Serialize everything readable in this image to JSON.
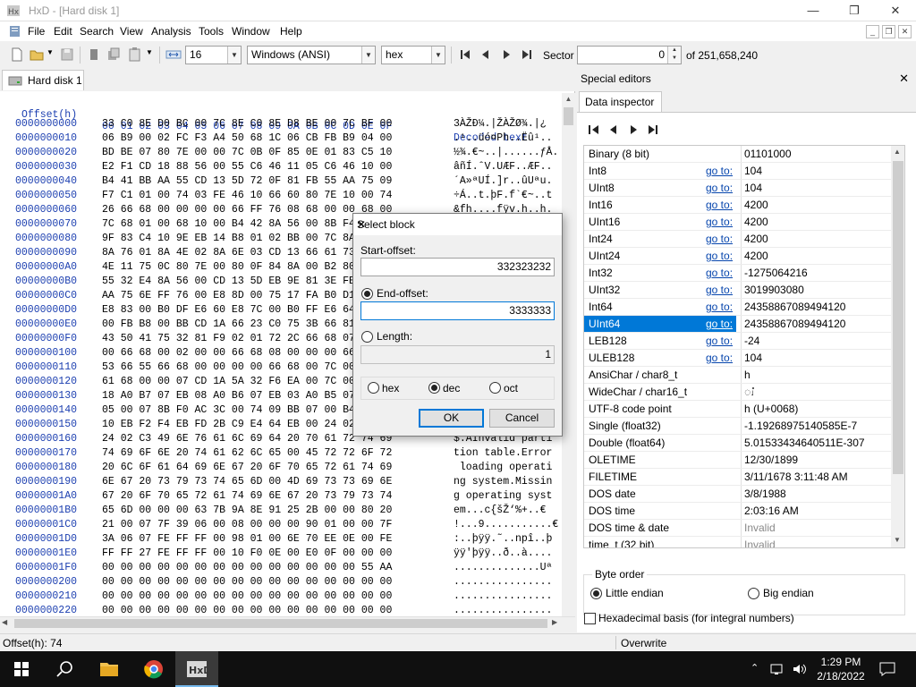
{
  "window": {
    "title": "HxD - [Hard disk 1]",
    "min_glyph": "—",
    "max_glyph": "❐",
    "close_glyph": "✕"
  },
  "menu": [
    "File",
    "Edit",
    "Search",
    "View",
    "Analysis",
    "Tools",
    "Window",
    "Help"
  ],
  "toolbar": {
    "columns": "16",
    "charset": "Windows (ANSI)",
    "display": "hex",
    "sector_label": "Sector",
    "sector_value": "0",
    "sector_total": "of 251,658,240"
  },
  "tab": {
    "label": "Hard disk 1"
  },
  "hex": {
    "header_offset": "Offset(h)",
    "header_bytes": "00 01 02 03 04 05 06 07 08 09 0A 0B 0C 0D 0E 0F",
    "header_decoded": "Decoded text",
    "rows": [
      {
        "off": "0000000000",
        "bytes": "33 C0 8E D0 BC 00 7C 8E C0 8E D8 BE 00 7C BF 00",
        "dec": "3ÀŽÐ¼.|ŽÀŽØ¾.|¿"
      },
      {
        "off": "0000000010",
        "bytes": "06 B9 00 02 FC F3 A4 50 68 1C 06 CB FB B9 04 00",
        "dec": ".¹..üó¤Ph..Ëû¹.."
      },
      {
        "off": "0000000020",
        "bytes": "BD BE 07 80 7E 00 00 7C 0B 0F 85 0E 01 83 C5 10",
        "dec": "½¾.€~..|......ƒÅ."
      },
      {
        "off": "0000000030",
        "bytes": "E2 F1 CD 18 88 56 00 55 C6 46 11 05 C6 46 10 00",
        "dec": "âñÍ.ˆV.UÆF..ÆF.."
      },
      {
        "off": "0000000040",
        "bytes": "B4 41 BB AA 55 CD 13 5D 72 0F 81 FB 55 AA 75 09",
        "dec": "´A»ªUÍ.]r..ûUªu."
      },
      {
        "off": "0000000050",
        "bytes": "F7 C1 01 00 74 03 FE 46 10 66 60 80 7E 10 00 74",
        "dec": "÷Á..t.þF.f`€~..t"
      },
      {
        "off": "0000000060",
        "bytes": "26 66 68 00 00 00 00 66 FF 76 08 68 00 00 68 00",
        "dec": "&fh....fÿv.h..h."
      },
      {
        "off": "0000000070",
        "bytes": "7C 68 01 00 68 10 00 B4 42 8A 56 00 8B F4 CD 13",
        "dec": "|h..h..´BŠV.‹ôÍ."
      },
      {
        "off": "0000000080",
        "bytes": "9F 83 C4 10 9E EB 14 B8 01 02 BB 00 7C 8A 56 00",
        "dec": "ŸƒÄ.žë.¸..».|ŠV."
      },
      {
        "off": "0000000090",
        "bytes": "8A 76 01 8A 4E 02 8A 6E 03 CD 13 66 61 73 1C FE",
        "dec": "Šv.ŠN.Šn.Í.fas.þ"
      },
      {
        "off": "00000000A0",
        "bytes": "4E 11 75 0C 80 7E 00 80 0F 84 8A 00 B2 80 EB 84",
        "dec": "N.u.€~.€.„Š.²€ë„"
      },
      {
        "off": "00000000B0",
        "bytes": "55 32 E4 8A 56 00 CD 13 5D EB 9E 81 3E FE 7D 55",
        "dec": "U2äŠV.Í.]ëž.>þ}U"
      },
      {
        "off": "00000000C0",
        "bytes": "AA 75 6E FF 76 00 E8 8D 00 75 17 FA B0 D1 E6 64",
        "dec": "ªunÿv.è..u.ú°Ñæd"
      },
      {
        "off": "00000000D0",
        "bytes": "E8 83 00 B0 DF E6 60 E8 7C 00 B0 FF E6 64 E8 75",
        "dec": "èƒ.°ßæ`è|.°ÿædèu"
      },
      {
        "off": "00000000E0",
        "bytes": "00 FB B8 00 BB CD 1A 66 23 C0 75 3B 66 81 FB 54",
        "dec": ".û¸.»Í.f#Àu;f.ûT"
      },
      {
        "off": "00000000F0",
        "bytes": "43 50 41 75 32 81 F9 02 01 72 2C 66 68 07 BB 00",
        "dec": "CPAu2.ù..r,fh.»."
      },
      {
        "off": "0000000100",
        "bytes": "00 66 68 00 02 00 00 66 68 08 00 00 00 66 53 66",
        "dec": ".fh....fh....fSf"
      },
      {
        "off": "0000000110",
        "bytes": "53 66 55 66 68 00 00 00 00 66 68 00 7C 00 00 66",
        "dec": "SfUfh....fh.|..f"
      },
      {
        "off": "0000000120",
        "bytes": "61 68 00 00 07 CD 1A 5A 32 F6 EA 00 7C 00 00 CD",
        "dec": "ah...Í.Z2öê.|..Í"
      },
      {
        "off": "0000000130",
        "bytes": "18 A0 B7 07 EB 08 A0 B6 07 EB 03 A0 B5 07 32 E4",
        "dec": ". ·.ë. ¶.ë. µ.2ä"
      },
      {
        "off": "0000000140",
        "bytes": "05 00 07 8B F0 AC 3C 00 74 09 BB 07 00 B4 0E CD",
        "dec": "...‹ð¬<.t.»..´.Í"
      },
      {
        "off": "0000000150",
        "bytes": "10 EB F2 F4 EB FD 2B C9 E4 64 EB 00 24 02 E0 F8",
        "dec": ".ëòôëý+Éädë.$.àø"
      },
      {
        "off": "0000000160",
        "bytes": "24 02 C3 49 6E 76 61 6C 69 64 20 70 61 72 74 69",
        "dec": "$.ÃInvalid parti"
      },
      {
        "off": "0000000170",
        "bytes": "74 69 6F 6E 20 74 61 62 6C 65 00 45 72 72 6F 72",
        "dec": "tion table.Error"
      },
      {
        "off": "0000000180",
        "bytes": "20 6C 6F 61 64 69 6E 67 20 6F 70 65 72 61 74 69",
        "dec": " loading operati"
      },
      {
        "off": "0000000190",
        "bytes": "6E 67 20 73 79 73 74 65 6D 00 4D 69 73 73 69 6E",
        "dec": "ng system.Missin"
      },
      {
        "off": "00000001A0",
        "bytes": "67 20 6F 70 65 72 61 74 69 6E 67 20 73 79 73 74",
        "dec": "g operating syst"
      },
      {
        "off": "00000001B0",
        "bytes": "65 6D 00 00 00 63 7B 9A 8E 91 25 2B 00 00 80 20",
        "dec": "em...c{šŽ‘%+..€ "
      },
      {
        "off": "00000001C0",
        "bytes": "21 00 07 7F 39 06 00 08 00 00 00 90 01 00 00 7F",
        "dec": "!...9...........€"
      },
      {
        "off": "00000001D0",
        "bytes": "3A 06 07 FE FF FF 00 98 01 00 6E 70 EE 0E 00 FE",
        "dec": ":..þÿÿ.˜..npî..þ"
      },
      {
        "off": "00000001E0",
        "bytes": "FF FF 27 FE FF FF 00 10 F0 0E 00 E0 0F 00 00 00",
        "dec": "ÿÿ'þÿÿ..ð..à...."
      },
      {
        "off": "00000001F0",
        "bytes": "00 00 00 00 00 00 00 00 00 00 00 00 00 00 55 AA",
        "dec": "..............Uª"
      },
      {
        "off": "0000000200",
        "bytes": "00 00 00 00 00 00 00 00 00 00 00 00 00 00 00 00",
        "dec": "................"
      },
      {
        "off": "0000000210",
        "bytes": "00 00 00 00 00 00 00 00 00 00 00 00 00 00 00 00",
        "dec": "................"
      },
      {
        "off": "0000000220",
        "bytes": "00 00 00 00 00 00 00 00 00 00 00 00 00 00 00 00",
        "dec": "................"
      }
    ]
  },
  "status": {
    "offset": "Offset(h): 74",
    "mode": "Overwrite"
  },
  "special_editors": {
    "title": "Special editors",
    "tab": "Data inspector"
  },
  "inspector": {
    "goto_label": "go to:",
    "rows": [
      {
        "name": "Binary (8 bit)",
        "goto": false,
        "value": "01101000"
      },
      {
        "name": "Int8",
        "goto": true,
        "value": "104"
      },
      {
        "name": "UInt8",
        "goto": true,
        "value": "104"
      },
      {
        "name": "Int16",
        "goto": true,
        "value": "4200"
      },
      {
        "name": "UInt16",
        "goto": true,
        "value": "4200"
      },
      {
        "name": "Int24",
        "goto": true,
        "value": "4200"
      },
      {
        "name": "UInt24",
        "goto": true,
        "value": "4200"
      },
      {
        "name": "Int32",
        "goto": true,
        "value": "-1275064216"
      },
      {
        "name": "UInt32",
        "goto": true,
        "value": "3019903080"
      },
      {
        "name": "Int64",
        "goto": true,
        "value": "24358867089494120"
      },
      {
        "name": "UInt64",
        "goto": true,
        "value": "24358867089494120",
        "selected": true
      },
      {
        "name": "LEB128",
        "goto": true,
        "value": "-24"
      },
      {
        "name": "ULEB128",
        "goto": true,
        "value": "104"
      },
      {
        "name": "AnsiChar / char8_t",
        "goto": false,
        "value": "h"
      },
      {
        "name": "WideChar / char16_t",
        "goto": false,
        "value": "ၨ"
      },
      {
        "name": "UTF-8 code point",
        "goto": false,
        "value": "h (U+0068)"
      },
      {
        "name": "Single (float32)",
        "goto": false,
        "value": "-1.19268975140585E-7"
      },
      {
        "name": "Double (float64)",
        "goto": false,
        "value": "5.01533434640511E-307"
      },
      {
        "name": "OLETIME",
        "goto": false,
        "value": "12/30/1899"
      },
      {
        "name": "FILETIME",
        "goto": false,
        "value": "3/11/1678 3:11:48 AM"
      },
      {
        "name": "DOS date",
        "goto": false,
        "value": "3/8/1988"
      },
      {
        "name": "DOS time",
        "goto": false,
        "value": "2:03:16 AM"
      },
      {
        "name": "DOS time & date",
        "goto": false,
        "value": "Invalid",
        "dim": true
      },
      {
        "name": "time_t (32 bit)",
        "goto": false,
        "value": "Invalid",
        "dim": true
      },
      {
        "name": "time_t (64 bit)",
        "goto": false,
        "value": "Invalid",
        "dim": true
      }
    ]
  },
  "byte_order": {
    "legend": "Byte order",
    "little": "Little endian",
    "big": "Big endian"
  },
  "hex_basis": "Hexadecimal basis (for integral numbers)",
  "dialog": {
    "title": "Select block",
    "start_label": "Start-offset:",
    "start_value": "332323232",
    "end_label": "End-offset:",
    "end_value": "3333333",
    "length_label": "Length:",
    "length_value": "1",
    "base_hex": "hex",
    "base_dec": "dec",
    "base_oct": "oct",
    "ok": "OK",
    "cancel": "Cancel"
  },
  "taskbar": {
    "time": "1:29 PM",
    "date": "2/18/2022"
  }
}
